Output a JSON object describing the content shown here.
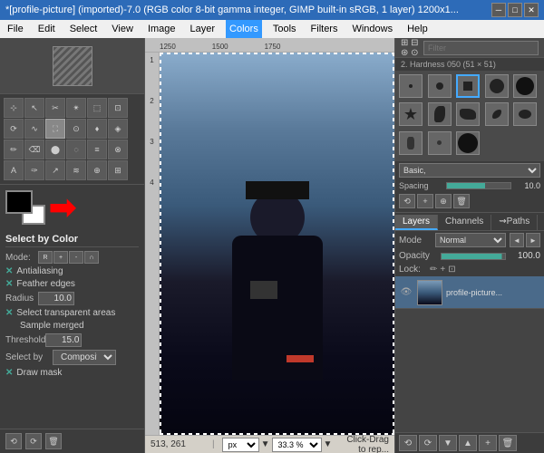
{
  "titlebar": {
    "title": "*[profile-picture] (imported)-7.0 (RGB color 8-bit gamma integer, GIMP built-in sRGB, 1 layer) 1200x1...",
    "minimize": "─",
    "maximize": "□",
    "close": "✕"
  },
  "menubar": {
    "items": [
      "File",
      "Edit",
      "Select",
      "View",
      "Image",
      "Layer",
      "Colors",
      "Tools",
      "Filters",
      "Windows",
      "Help"
    ]
  },
  "toolbox": {
    "tools": [
      "⊹",
      "↖",
      "✂",
      "✴",
      "⬚",
      "⊡",
      "⟳",
      "∿",
      "⛶",
      "⚙",
      "♦",
      "☉",
      "✏",
      "⌫",
      "⬤",
      "◌",
      "≡",
      "⊗",
      "A",
      "T",
      "↗",
      "≋",
      "⊕",
      "⊞",
      "🔍",
      "",
      "",
      "",
      "",
      ""
    ]
  },
  "colors": {
    "fg": "#000000",
    "bg": "#ffffff"
  },
  "toolOptions": {
    "title": "Select by Color",
    "modeLabel": "Mode:",
    "antialiasingLabel": "Antialiasing",
    "antialiasingChecked": true,
    "featherEdgesLabel": "Feather edges",
    "featherEdgesChecked": true,
    "radiusLabel": "Radius",
    "radiusValue": "10.0",
    "selectTransparentLabel": "Select transparent areas",
    "selectTransparentChecked": true,
    "sampleMergedLabel": "Sample merged",
    "sampleMergedChecked": false,
    "thresholdLabel": "Threshold",
    "thresholdValue": "15.0",
    "selectByLabel": "Select by",
    "selectByValue": "Composite",
    "drawMaskLabel": "Draw mask",
    "drawMaskChecked": true
  },
  "bottomIcons": [
    "⟲",
    "⟳",
    "🗑"
  ],
  "canvas": {
    "rulerMarks": [
      "1250",
      "1500",
      "1750"
    ],
    "rulerMarksV": [
      "1",
      "2",
      "3",
      "4"
    ],
    "coords": "513, 261",
    "unit": "px",
    "zoom": "33.3 %",
    "message": "Click-Drag to rep..."
  },
  "brushes": {
    "filterPlaceholder": "Filter",
    "brushInfo": "2. Hardness 050 (51 × 51)",
    "presetLabel": "Basic,",
    "spacingLabel": "Spacing",
    "spacingValue": "10.0"
  },
  "layers": {
    "tabs": [
      "Layers",
      "Channels",
      "Paths"
    ],
    "activeTab": "Layers",
    "modeLabel": "Mode",
    "modeValue": "Normal",
    "opacityLabel": "Opacity",
    "opacityValue": "100.0",
    "lockLabel": "Lock:",
    "items": [
      {
        "name": "profile-picture...",
        "visible": true,
        "selected": true
      }
    ],
    "controls": [
      "⟲",
      "⟳",
      "▼",
      "▲",
      "+",
      "🗑"
    ]
  }
}
